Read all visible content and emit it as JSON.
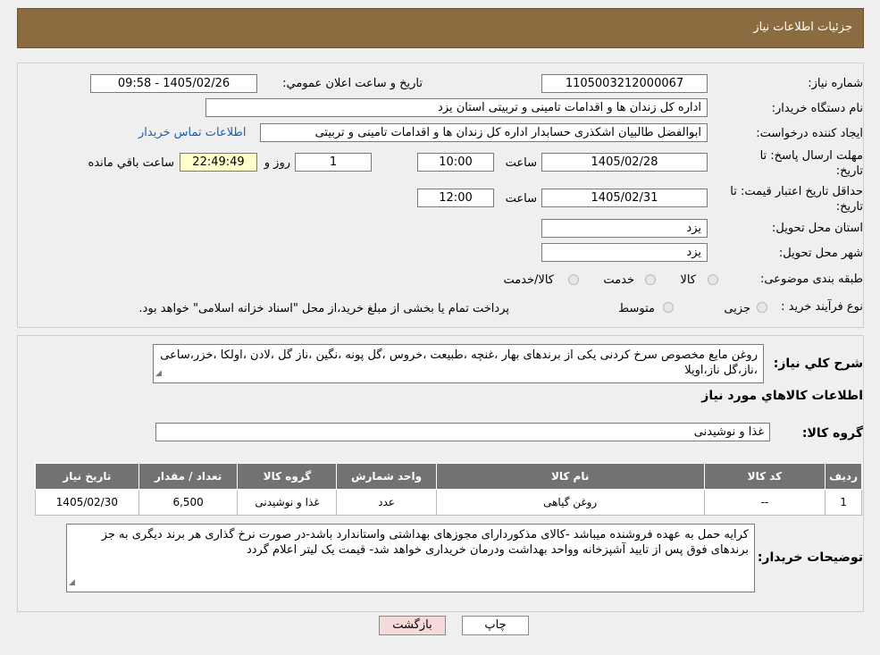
{
  "header": {
    "title": "جزئیات اطلاعات نیاز"
  },
  "form": {
    "need_number_label": "شماره نیاز:",
    "need_number": "1105003212000067",
    "announce_label": "تاریخ و ساعت اعلان عمومي:",
    "announce_value": "1405/02/26 - 09:58",
    "buyer_label": "نام دستگاه خریدار:",
    "buyer": "اداره کل زندان ها و اقدامات تامینی و تربیتی استان یزد",
    "creator_label": "ایجاد کننده درخواست:",
    "creator": "ابوالفضل  طالبیان اشکذری حسابدار اداره کل زندان ها و اقدامات تامینی و تربیتی",
    "contact_link": "اطلاعات تماس خریدار",
    "deadline_label": "مهلت ارسال پاسخ: تا تاریخ:",
    "deadline_date": "1405/02/28",
    "time_label": "ساعت",
    "deadline_time": "10:00",
    "days": "1",
    "days_label": "روز و",
    "remaining_time": "22:49:49",
    "remaining_label": "ساعت باقي مانده",
    "validity_label": "حداقل تاریخ اعتبار قیمت: تا تاریخ:",
    "validity_date": "1405/02/31",
    "validity_time": "12:00",
    "province_label": "استان محل تحویل:",
    "province": "یزد",
    "city_label": "شهر محل تحویل:",
    "city": "یزد",
    "category_label": "طبقه بندی موضوعی:",
    "category_options": [
      "کالا",
      "خدمت",
      "کالا/خدمت"
    ],
    "process_label": "نوع فرآیند خرید :",
    "process_options": [
      "جزیی",
      "متوسط"
    ],
    "process_note": "پرداخت تمام یا بخشی از مبلغ خرید،از محل \"اسناد خزانه اسلامی\" خواهد بود."
  },
  "description": {
    "label": "شرح کلي نياز:",
    "text": "روغن مایع مخصوص سرخ کردنی  یکی از برندهای بهار ،غنچه ،طبیعت ،خروس ،گل پونه ،نگین ،ناز گل ،لادن ،اولکا ،خزر،ساعی ،ناز،گل ناز،اویلا",
    "goods_title": "اطلاعات کالاهاي مورد نياز",
    "group_label": "گروه کالا:",
    "group_value": "غذا و نوشیدنی"
  },
  "table": {
    "headers": [
      "ردیف",
      "کد کالا",
      "نام کالا",
      "واحد شمارش",
      "گروه کالا",
      "تعداد / مقدار",
      "تاریخ نیاز"
    ],
    "rows": [
      [
        "1",
        "--",
        "روغن گیاهی",
        "عدد",
        "غذا و نوشیدنی",
        "6,500",
        "1405/02/30"
      ]
    ]
  },
  "buyer_notes": {
    "label": "توضیحات خریدار:",
    "text": "کرایه حمل به عهده فروشنده میباشد -کالای مذکوردارای مجوزهای بهداشتی واستاندارد باشد-در صورت نرخ گذاری هر برند دیگری به جز برندهای فوق پس از تایید آشپزخانه وواحد بهداشت ودرمان خریداری خواهد شد- قیمت یک لیتر اعلام گردد"
  },
  "buttons": {
    "print": "چاپ",
    "back": "بازگشت"
  },
  "colors": {
    "header_bg": "#8b6b40",
    "table_header": "#727272",
    "back_btn": "#f6d9d9",
    "print_btn": "#ffffff"
  }
}
